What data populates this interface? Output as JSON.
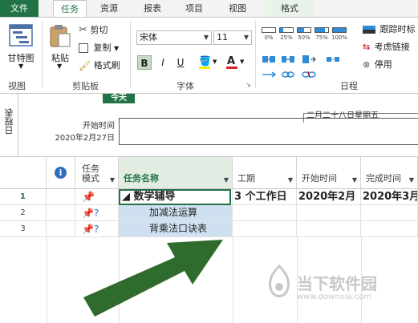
{
  "tabs": [
    "文件",
    "任务",
    "资源",
    "报表",
    "项目",
    "视图",
    "格式"
  ],
  "ribbon": {
    "view_group": {
      "button": "甘特图",
      "label": "视图"
    },
    "clipboard_group": {
      "paste": "粘贴",
      "cut": "剪切",
      "copy": "复制",
      "format_painter": "格式刷",
      "label": "剪贴板"
    },
    "font_group": {
      "font_name": "宋体",
      "font_size": "11",
      "bold": "B",
      "italic": "I",
      "underline": "U",
      "font_color_letter": "A",
      "label": "字体"
    },
    "schedule_group": {
      "percents": [
        "0%",
        "25%",
        "50%",
        "75%",
        "100%"
      ],
      "track": "跟踪时标",
      "respect_links": "考虑链接",
      "inactivate": "停用",
      "label": "日程"
    }
  },
  "timeline": {
    "side_label": "日程表",
    "today": "今天",
    "start_label": "开始时间",
    "start_date": "2020年2月27日",
    "date_label": "二月二十八日星期五"
  },
  "grid": {
    "headers": {
      "info": "i",
      "mode": "任务\n模式",
      "name": "任务名称",
      "duration": "工期",
      "start": "开始时间",
      "finish": "完成时间"
    },
    "rows": [
      {
        "num": "1",
        "name": "◢ 数学辅导",
        "duration": "3 个工作日",
        "start": "2020年2月",
        "finish": "2020年3月"
      },
      {
        "num": "2",
        "name": "加减法运算",
        "duration": "",
        "start": "",
        "finish": ""
      },
      {
        "num": "3",
        "name": "背乘法口诀表",
        "duration": "",
        "start": "",
        "finish": ""
      }
    ]
  },
  "watermark": {
    "title": "当下软件园",
    "url": "www.downxia.com"
  },
  "colors": {
    "accent": "#217346",
    "selection_fill": "#cfe0f1",
    "arrow": "#2f6b2d"
  }
}
